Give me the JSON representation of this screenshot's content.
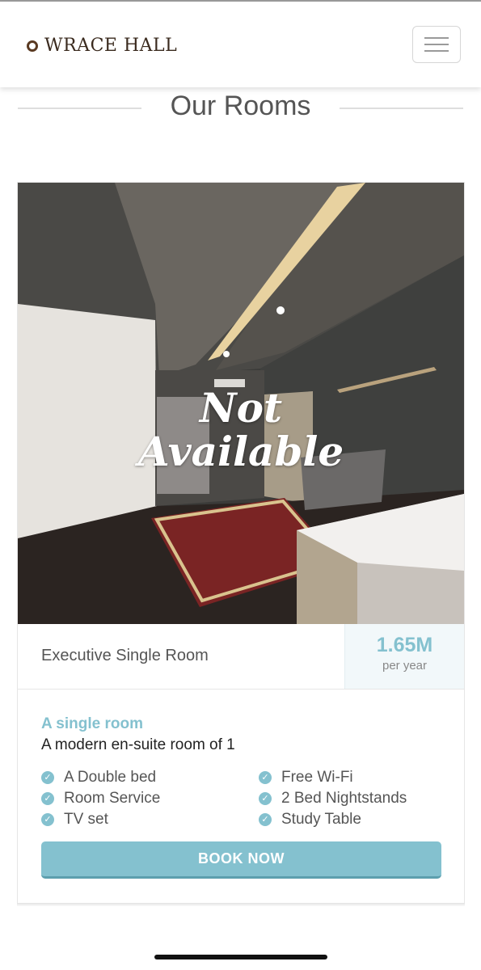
{
  "header": {
    "logo_text": "WRACE HALL",
    "menu_icon": "hamburger-icon"
  },
  "section": {
    "title": "Our Rooms"
  },
  "room": {
    "overlay_line1": "Not",
    "overlay_line2": "Available",
    "name": "Executive Single Room",
    "price": "1.65M",
    "price_period": "per year",
    "subtitle": "A single room",
    "description": "A modern en-suite room of 1",
    "features_left": [
      "A Double bed",
      "Room Service",
      "TV set"
    ],
    "features_right": [
      "Free Wi-Fi",
      "2 Bed Nightstands",
      "Study Table"
    ],
    "book_label": "BOOK NOW",
    "check_icon": "check-circle-icon"
  },
  "colors": {
    "accent": "#84c1cf",
    "logo": "#3a2a1e"
  }
}
